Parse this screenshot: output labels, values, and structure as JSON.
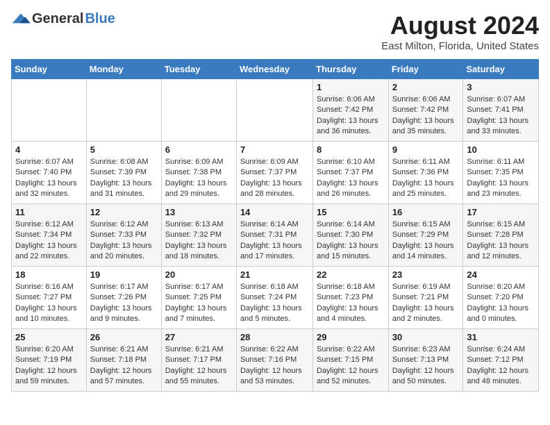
{
  "header": {
    "logo_general": "General",
    "logo_blue": "Blue",
    "title": "August 2024",
    "subtitle": "East Milton, Florida, United States"
  },
  "calendar": {
    "days_of_week": [
      "Sunday",
      "Monday",
      "Tuesday",
      "Wednesday",
      "Thursday",
      "Friday",
      "Saturday"
    ],
    "weeks": [
      [
        {
          "day": "",
          "info": ""
        },
        {
          "day": "",
          "info": ""
        },
        {
          "day": "",
          "info": ""
        },
        {
          "day": "",
          "info": ""
        },
        {
          "day": "1",
          "info": "Sunrise: 6:06 AM\nSunset: 7:42 PM\nDaylight: 13 hours and 36 minutes."
        },
        {
          "day": "2",
          "info": "Sunrise: 6:06 AM\nSunset: 7:42 PM\nDaylight: 13 hours and 35 minutes."
        },
        {
          "day": "3",
          "info": "Sunrise: 6:07 AM\nSunset: 7:41 PM\nDaylight: 13 hours and 33 minutes."
        }
      ],
      [
        {
          "day": "4",
          "info": "Sunrise: 6:07 AM\nSunset: 7:40 PM\nDaylight: 13 hours and 32 minutes."
        },
        {
          "day": "5",
          "info": "Sunrise: 6:08 AM\nSunset: 7:39 PM\nDaylight: 13 hours and 31 minutes."
        },
        {
          "day": "6",
          "info": "Sunrise: 6:09 AM\nSunset: 7:38 PM\nDaylight: 13 hours and 29 minutes."
        },
        {
          "day": "7",
          "info": "Sunrise: 6:09 AM\nSunset: 7:37 PM\nDaylight: 13 hours and 28 minutes."
        },
        {
          "day": "8",
          "info": "Sunrise: 6:10 AM\nSunset: 7:37 PM\nDaylight: 13 hours and 26 minutes."
        },
        {
          "day": "9",
          "info": "Sunrise: 6:11 AM\nSunset: 7:36 PM\nDaylight: 13 hours and 25 minutes."
        },
        {
          "day": "10",
          "info": "Sunrise: 6:11 AM\nSunset: 7:35 PM\nDaylight: 13 hours and 23 minutes."
        }
      ],
      [
        {
          "day": "11",
          "info": "Sunrise: 6:12 AM\nSunset: 7:34 PM\nDaylight: 13 hours and 22 minutes."
        },
        {
          "day": "12",
          "info": "Sunrise: 6:12 AM\nSunset: 7:33 PM\nDaylight: 13 hours and 20 minutes."
        },
        {
          "day": "13",
          "info": "Sunrise: 6:13 AM\nSunset: 7:32 PM\nDaylight: 13 hours and 18 minutes."
        },
        {
          "day": "14",
          "info": "Sunrise: 6:14 AM\nSunset: 7:31 PM\nDaylight: 13 hours and 17 minutes."
        },
        {
          "day": "15",
          "info": "Sunrise: 6:14 AM\nSunset: 7:30 PM\nDaylight: 13 hours and 15 minutes."
        },
        {
          "day": "16",
          "info": "Sunrise: 6:15 AM\nSunset: 7:29 PM\nDaylight: 13 hours and 14 minutes."
        },
        {
          "day": "17",
          "info": "Sunrise: 6:15 AM\nSunset: 7:28 PM\nDaylight: 13 hours and 12 minutes."
        }
      ],
      [
        {
          "day": "18",
          "info": "Sunrise: 6:16 AM\nSunset: 7:27 PM\nDaylight: 13 hours and 10 minutes."
        },
        {
          "day": "19",
          "info": "Sunrise: 6:17 AM\nSunset: 7:26 PM\nDaylight: 13 hours and 9 minutes."
        },
        {
          "day": "20",
          "info": "Sunrise: 6:17 AM\nSunset: 7:25 PM\nDaylight: 13 hours and 7 minutes."
        },
        {
          "day": "21",
          "info": "Sunrise: 6:18 AM\nSunset: 7:24 PM\nDaylight: 13 hours and 5 minutes."
        },
        {
          "day": "22",
          "info": "Sunrise: 6:18 AM\nSunset: 7:23 PM\nDaylight: 13 hours and 4 minutes."
        },
        {
          "day": "23",
          "info": "Sunrise: 6:19 AM\nSunset: 7:21 PM\nDaylight: 13 hours and 2 minutes."
        },
        {
          "day": "24",
          "info": "Sunrise: 6:20 AM\nSunset: 7:20 PM\nDaylight: 13 hours and 0 minutes."
        }
      ],
      [
        {
          "day": "25",
          "info": "Sunrise: 6:20 AM\nSunset: 7:19 PM\nDaylight: 12 hours and 59 minutes."
        },
        {
          "day": "26",
          "info": "Sunrise: 6:21 AM\nSunset: 7:18 PM\nDaylight: 12 hours and 57 minutes."
        },
        {
          "day": "27",
          "info": "Sunrise: 6:21 AM\nSunset: 7:17 PM\nDaylight: 12 hours and 55 minutes."
        },
        {
          "day": "28",
          "info": "Sunrise: 6:22 AM\nSunset: 7:16 PM\nDaylight: 12 hours and 53 minutes."
        },
        {
          "day": "29",
          "info": "Sunrise: 6:22 AM\nSunset: 7:15 PM\nDaylight: 12 hours and 52 minutes."
        },
        {
          "day": "30",
          "info": "Sunrise: 6:23 AM\nSunset: 7:13 PM\nDaylight: 12 hours and 50 minutes."
        },
        {
          "day": "31",
          "info": "Sunrise: 6:24 AM\nSunset: 7:12 PM\nDaylight: 12 hours and 48 minutes."
        }
      ]
    ]
  }
}
